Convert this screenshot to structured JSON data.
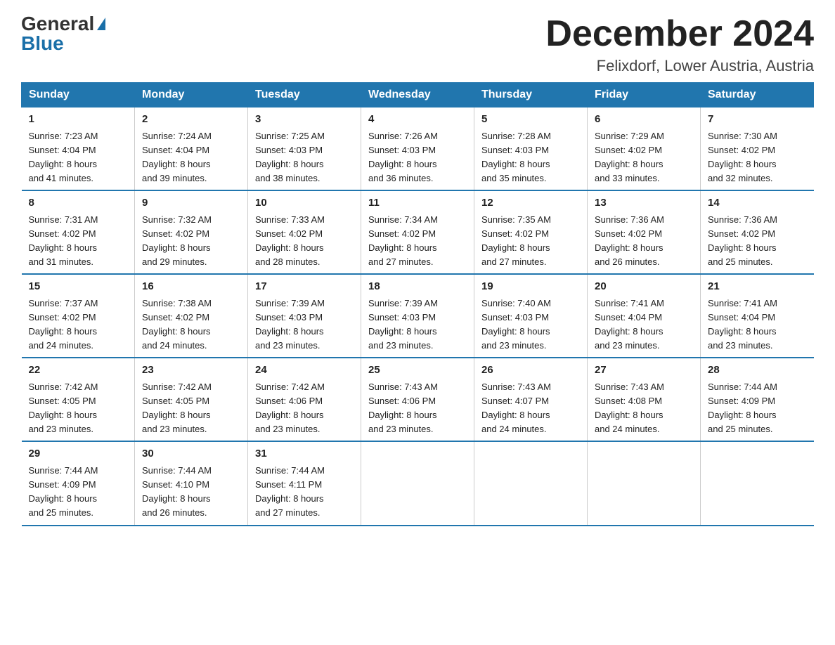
{
  "logo": {
    "general": "General",
    "blue": "Blue"
  },
  "title": "December 2024",
  "location": "Felixdorf, Lower Austria, Austria",
  "weekdays": [
    "Sunday",
    "Monday",
    "Tuesday",
    "Wednesday",
    "Thursday",
    "Friday",
    "Saturday"
  ],
  "weeks": [
    [
      {
        "day": "1",
        "info": "Sunrise: 7:23 AM\nSunset: 4:04 PM\nDaylight: 8 hours\nand 41 minutes."
      },
      {
        "day": "2",
        "info": "Sunrise: 7:24 AM\nSunset: 4:04 PM\nDaylight: 8 hours\nand 39 minutes."
      },
      {
        "day": "3",
        "info": "Sunrise: 7:25 AM\nSunset: 4:03 PM\nDaylight: 8 hours\nand 38 minutes."
      },
      {
        "day": "4",
        "info": "Sunrise: 7:26 AM\nSunset: 4:03 PM\nDaylight: 8 hours\nand 36 minutes."
      },
      {
        "day": "5",
        "info": "Sunrise: 7:28 AM\nSunset: 4:03 PM\nDaylight: 8 hours\nand 35 minutes."
      },
      {
        "day": "6",
        "info": "Sunrise: 7:29 AM\nSunset: 4:02 PM\nDaylight: 8 hours\nand 33 minutes."
      },
      {
        "day": "7",
        "info": "Sunrise: 7:30 AM\nSunset: 4:02 PM\nDaylight: 8 hours\nand 32 minutes."
      }
    ],
    [
      {
        "day": "8",
        "info": "Sunrise: 7:31 AM\nSunset: 4:02 PM\nDaylight: 8 hours\nand 31 minutes."
      },
      {
        "day": "9",
        "info": "Sunrise: 7:32 AM\nSunset: 4:02 PM\nDaylight: 8 hours\nand 29 minutes."
      },
      {
        "day": "10",
        "info": "Sunrise: 7:33 AM\nSunset: 4:02 PM\nDaylight: 8 hours\nand 28 minutes."
      },
      {
        "day": "11",
        "info": "Sunrise: 7:34 AM\nSunset: 4:02 PM\nDaylight: 8 hours\nand 27 minutes."
      },
      {
        "day": "12",
        "info": "Sunrise: 7:35 AM\nSunset: 4:02 PM\nDaylight: 8 hours\nand 27 minutes."
      },
      {
        "day": "13",
        "info": "Sunrise: 7:36 AM\nSunset: 4:02 PM\nDaylight: 8 hours\nand 26 minutes."
      },
      {
        "day": "14",
        "info": "Sunrise: 7:36 AM\nSunset: 4:02 PM\nDaylight: 8 hours\nand 25 minutes."
      }
    ],
    [
      {
        "day": "15",
        "info": "Sunrise: 7:37 AM\nSunset: 4:02 PM\nDaylight: 8 hours\nand 24 minutes."
      },
      {
        "day": "16",
        "info": "Sunrise: 7:38 AM\nSunset: 4:02 PM\nDaylight: 8 hours\nand 24 minutes."
      },
      {
        "day": "17",
        "info": "Sunrise: 7:39 AM\nSunset: 4:03 PM\nDaylight: 8 hours\nand 23 minutes."
      },
      {
        "day": "18",
        "info": "Sunrise: 7:39 AM\nSunset: 4:03 PM\nDaylight: 8 hours\nand 23 minutes."
      },
      {
        "day": "19",
        "info": "Sunrise: 7:40 AM\nSunset: 4:03 PM\nDaylight: 8 hours\nand 23 minutes."
      },
      {
        "day": "20",
        "info": "Sunrise: 7:41 AM\nSunset: 4:04 PM\nDaylight: 8 hours\nand 23 minutes."
      },
      {
        "day": "21",
        "info": "Sunrise: 7:41 AM\nSunset: 4:04 PM\nDaylight: 8 hours\nand 23 minutes."
      }
    ],
    [
      {
        "day": "22",
        "info": "Sunrise: 7:42 AM\nSunset: 4:05 PM\nDaylight: 8 hours\nand 23 minutes."
      },
      {
        "day": "23",
        "info": "Sunrise: 7:42 AM\nSunset: 4:05 PM\nDaylight: 8 hours\nand 23 minutes."
      },
      {
        "day": "24",
        "info": "Sunrise: 7:42 AM\nSunset: 4:06 PM\nDaylight: 8 hours\nand 23 minutes."
      },
      {
        "day": "25",
        "info": "Sunrise: 7:43 AM\nSunset: 4:06 PM\nDaylight: 8 hours\nand 23 minutes."
      },
      {
        "day": "26",
        "info": "Sunrise: 7:43 AM\nSunset: 4:07 PM\nDaylight: 8 hours\nand 24 minutes."
      },
      {
        "day": "27",
        "info": "Sunrise: 7:43 AM\nSunset: 4:08 PM\nDaylight: 8 hours\nand 24 minutes."
      },
      {
        "day": "28",
        "info": "Sunrise: 7:44 AM\nSunset: 4:09 PM\nDaylight: 8 hours\nand 25 minutes."
      }
    ],
    [
      {
        "day": "29",
        "info": "Sunrise: 7:44 AM\nSunset: 4:09 PM\nDaylight: 8 hours\nand 25 minutes."
      },
      {
        "day": "30",
        "info": "Sunrise: 7:44 AM\nSunset: 4:10 PM\nDaylight: 8 hours\nand 26 minutes."
      },
      {
        "day": "31",
        "info": "Sunrise: 7:44 AM\nSunset: 4:11 PM\nDaylight: 8 hours\nand 27 minutes."
      },
      {
        "day": "",
        "info": ""
      },
      {
        "day": "",
        "info": ""
      },
      {
        "day": "",
        "info": ""
      },
      {
        "day": "",
        "info": ""
      }
    ]
  ]
}
